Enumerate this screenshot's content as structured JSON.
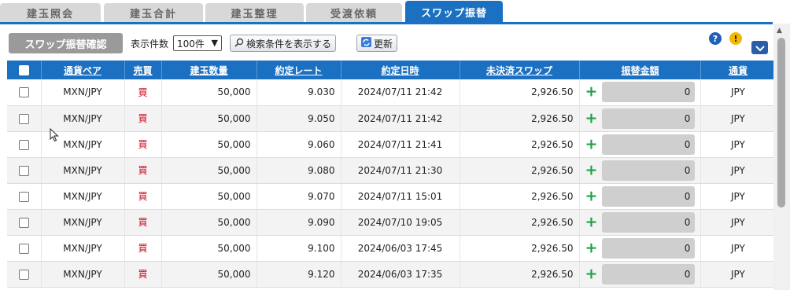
{
  "tabs": [
    {
      "label": "建玉照会"
    },
    {
      "label": "建玉合計"
    },
    {
      "label": "建玉整理"
    },
    {
      "label": "受渡依頼"
    },
    {
      "label": "スワップ振替"
    }
  ],
  "toolbar": {
    "confirm_label": "スワップ振替確認",
    "count_label": "表示件数",
    "count_value": "100件",
    "search_label": "検索条件を表示する",
    "refresh_label": "更新"
  },
  "table": {
    "headers": [
      "通貨ペア",
      "売買",
      "建玉数量",
      "約定レート",
      "約定日時",
      "未決済スワップ",
      "振替金額",
      "通貨"
    ],
    "rows": [
      {
        "pair": "MXN/JPY",
        "side": "買",
        "qty": "50,000",
        "rate": "9.030",
        "datetime": "2024/07/11 21:42",
        "swap": "2,926.50",
        "amount": "0",
        "currency": "JPY"
      },
      {
        "pair": "MXN/JPY",
        "side": "買",
        "qty": "50,000",
        "rate": "9.050",
        "datetime": "2024/07/11 21:42",
        "swap": "2,926.50",
        "amount": "0",
        "currency": "JPY"
      },
      {
        "pair": "MXN/JPY",
        "side": "買",
        "qty": "50,000",
        "rate": "9.060",
        "datetime": "2024/07/11 21:41",
        "swap": "2,926.50",
        "amount": "0",
        "currency": "JPY"
      },
      {
        "pair": "MXN/JPY",
        "side": "買",
        "qty": "50,000",
        "rate": "9.080",
        "datetime": "2024/07/11 21:30",
        "swap": "2,926.50",
        "amount": "0",
        "currency": "JPY"
      },
      {
        "pair": "MXN/JPY",
        "side": "買",
        "qty": "50,000",
        "rate": "9.070",
        "datetime": "2024/07/11 15:01",
        "swap": "2,926.50",
        "amount": "0",
        "currency": "JPY"
      },
      {
        "pair": "MXN/JPY",
        "side": "買",
        "qty": "50,000",
        "rate": "9.090",
        "datetime": "2024/07/10 19:05",
        "swap": "2,926.50",
        "amount": "0",
        "currency": "JPY"
      },
      {
        "pair": "MXN/JPY",
        "side": "買",
        "qty": "50,000",
        "rate": "9.100",
        "datetime": "2024/06/03 17:45",
        "swap": "2,926.50",
        "amount": "0",
        "currency": "JPY"
      },
      {
        "pair": "MXN/JPY",
        "side": "買",
        "qty": "50,000",
        "rate": "9.120",
        "datetime": "2024/06/03 17:35",
        "swap": "2,926.50",
        "amount": "0",
        "currency": "JPY"
      }
    ]
  },
  "icons": {
    "help": "help-icon",
    "warning": "warning-icon",
    "collapse": "chevron-down-icon",
    "search": "search-icon",
    "refresh": "refresh-icon",
    "add": "plus-icon"
  },
  "colors": {
    "accent": "#1c70c2",
    "buy": "#d0021b",
    "add": "#21a04a",
    "confirm_disabled": "#9a9a9a"
  }
}
